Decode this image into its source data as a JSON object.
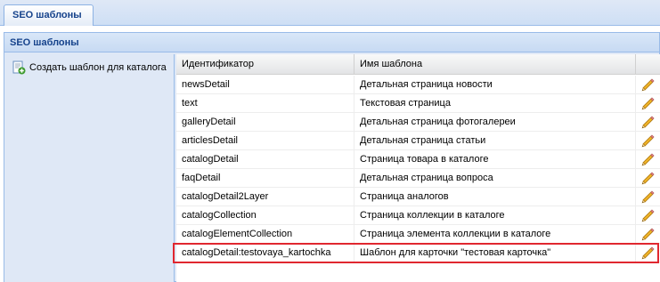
{
  "tabs": [
    {
      "label": "SEO шаблоны"
    }
  ],
  "panel": {
    "title": "SEO шаблоны"
  },
  "sidebar": {
    "create_label": "Создать шаблон для каталога",
    "create_icon": "add-document-icon"
  },
  "grid": {
    "columns": [
      "Идентификатор",
      "Имя шаблона",
      ""
    ],
    "rows": [
      {
        "id": "newsDetail",
        "name": "Детальная страница новости"
      },
      {
        "id": "text",
        "name": "Текстовая страница"
      },
      {
        "id": "galleryDetail",
        "name": "Детальная страница фотогалереи"
      },
      {
        "id": "articlesDetail",
        "name": "Детальная страница статьи"
      },
      {
        "id": "catalogDetail",
        "name": "Страница товара в каталоге"
      },
      {
        "id": "faqDetail",
        "name": "Детальная страница вопроса"
      },
      {
        "id": "catalogDetail2Layer",
        "name": "Страница аналогов"
      },
      {
        "id": "catalogCollection",
        "name": "Страница коллекции в каталоге"
      },
      {
        "id": "catalogElementCollection",
        "name": "Страница элемента коллекции в каталоге"
      },
      {
        "id": "catalogDetail:testovaya_kartochka",
        "name": "Шаблон для карточки \"тестовая карточка\""
      }
    ],
    "edit_icon": "pencil-icon",
    "highlight_color": "#e0272f"
  }
}
